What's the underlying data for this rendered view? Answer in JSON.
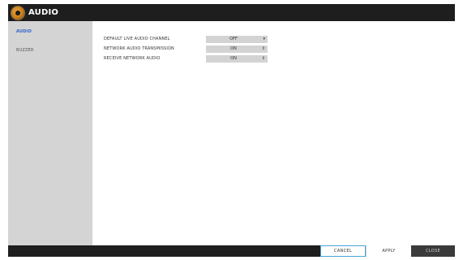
{
  "window": {
    "title": "AUDIO",
    "logo_icon": "audio-logo-icon"
  },
  "sidebar": {
    "items": [
      {
        "label": "AUDIO",
        "active": true
      },
      {
        "label": "BUZZER",
        "active": false
      }
    ]
  },
  "settings": [
    {
      "label": "DEFAULT LIVE AUDIO CHANNEL",
      "value": "OFF",
      "icon": "dropdown-arrow-icon",
      "icon_glyph": "▾"
    },
    {
      "label": "NETWORK AUDIO TRANSMISSION",
      "value": "ON",
      "icon": "up-down-arrow-icon",
      "icon_glyph": "⇕"
    },
    {
      "label": "RECEIVE NETWORK AUDIO",
      "value": "ON",
      "icon": "up-down-arrow-icon",
      "icon_glyph": "⇕"
    }
  ],
  "footer": {
    "cancel_label": "CANCEL",
    "apply_label": "APPLY",
    "close_label": "CLOSE"
  },
  "colors": {
    "title_bar": "#1e1e1e",
    "sidebar_bg": "#d4d4d4",
    "active_item": "#2b63c6",
    "select_bg": "#d3d3d3",
    "cancel_border": "#4aa3d8"
  }
}
